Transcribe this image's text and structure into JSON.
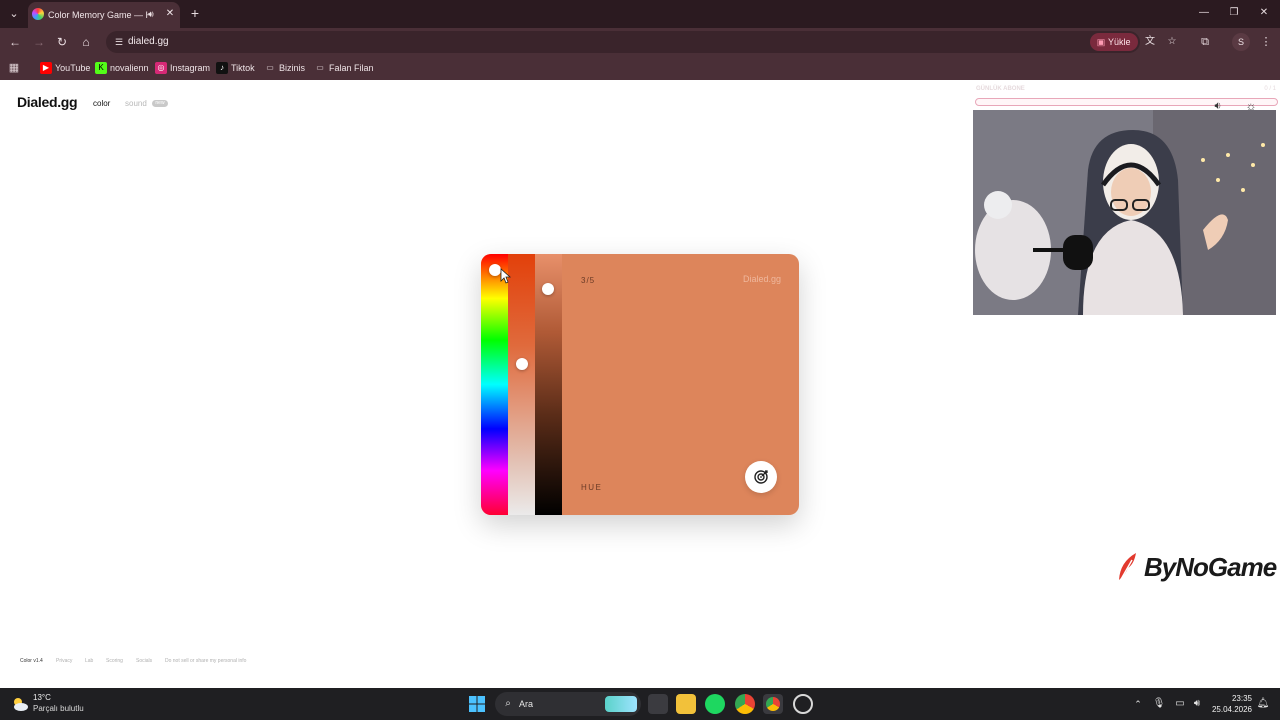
{
  "browser": {
    "tab": {
      "title": "Color Memory Game — Hu",
      "audio_icon": "speaker-icon",
      "close_icon": "close-icon"
    },
    "new_tab_label": "+",
    "window_controls": {
      "minimize": "—",
      "restore": "❐",
      "close": "✕"
    },
    "address": {
      "url": "dialed.gg"
    },
    "install_label": "Yükle",
    "profile_initial": "S",
    "bookmarks": [
      {
        "label": "YouTube",
        "icon": "youtube-icon",
        "color": "#ff0000"
      },
      {
        "label": "novalienn",
        "icon": "kick-icon",
        "color": "#53fc18"
      },
      {
        "label": "Instagram",
        "icon": "instagram-icon",
        "color": "#d62976"
      },
      {
        "label": "Tiktok",
        "icon": "tiktok-icon",
        "color": "#111111"
      },
      {
        "label": "Bizinis",
        "icon": "folder-icon",
        "color": "#4a2f37"
      },
      {
        "label": "Falan Filan",
        "icon": "folder-icon",
        "color": "#4a2f37"
      }
    ]
  },
  "site": {
    "logo": "Dialed.gg",
    "modes": {
      "color": "color",
      "sound": "sound",
      "sound_badge": "new"
    }
  },
  "game": {
    "progress": "3/5",
    "watermark": "Dialed.gg",
    "slider_label": "HUE",
    "target_color": "#dd855b",
    "hue_position": 0.04,
    "saturation_position": 0.4,
    "brightness_position": 0.11
  },
  "footer": {
    "version": "Color v1.4",
    "links": [
      "Privacy",
      "Lab",
      "Scoring",
      "Socials",
      "Do not sell or share my personal info"
    ]
  },
  "overlay": {
    "title": "GÜNLÜK ABONE",
    "count": "0 / 1",
    "brand": "ByNoGame"
  },
  "taskbar": {
    "weather": {
      "temp": "13°C",
      "desc": "Parçalı bulutlu"
    },
    "search_label": "Ara",
    "clock": {
      "time": "23:35",
      "date": "25.04.2026"
    }
  }
}
